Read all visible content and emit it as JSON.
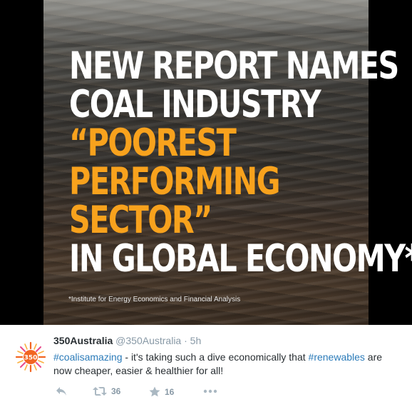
{
  "media": {
    "headline_lines": [
      {
        "text": "NEW REPORT NAMES",
        "color": "white"
      },
      {
        "text": "COAL INDUSTRY",
        "color": "white"
      },
      {
        "text": "“POOREST",
        "color": "orange"
      },
      {
        "text": "PERFORMING",
        "color": "orange"
      },
      {
        "text": "SECTOR”",
        "color": "orange"
      },
      {
        "text": "IN GLOBAL ECONOMY*",
        "color": "white"
      }
    ],
    "footnote": "*Institute for Energy Economics and Financial Analysis",
    "colors": {
      "highlight": "#f8a21d",
      "text": "#ffffff"
    }
  },
  "tweet": {
    "avatar_label": "350",
    "display_name": "350Australia",
    "handle": "@350Australia",
    "separator": "·",
    "time": "5h",
    "hashtag_1": "#coalisamazing",
    "text_1": " - it's taking such a dive economically that ",
    "hashtag_2": "#renewables",
    "text_2": " are now cheaper, easier & healthier for all!",
    "actions": {
      "reply_icon": "reply-icon",
      "retweet_icon": "retweet-icon",
      "retweet_count": "36",
      "favorite_icon": "star-icon",
      "favorite_count": "16",
      "more_icon": "more-icon"
    },
    "colors": {
      "link": "#2b7bb9",
      "muted": "#8899a6",
      "text": "#292f33"
    }
  }
}
